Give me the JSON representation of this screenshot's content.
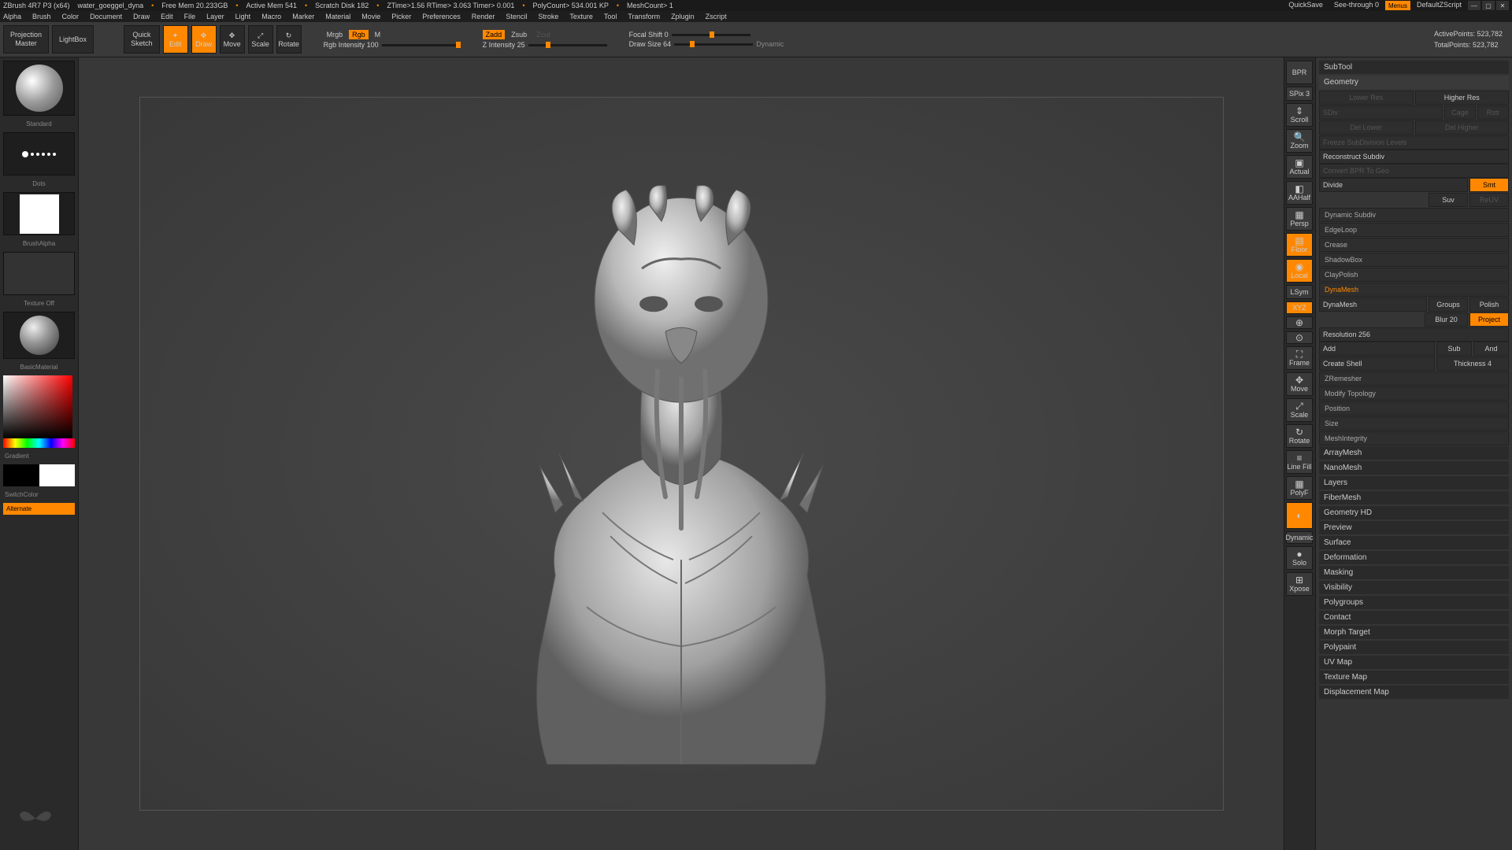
{
  "title_bar": {
    "app": "ZBrush 4R7 P3 (x64)",
    "file": "water_goeggel_dyna",
    "free_mem": "Free Mem 20.233GB",
    "active_mem": "Active Mem 541",
    "scratch": "Scratch Disk 182",
    "ztime": "ZTime>1.56 RTime> 3.063 Timer> 0.001",
    "polycount": "PolyCount> 534.001 KP",
    "meshcount": "MeshCount> 1",
    "quicksave": "QuickSave",
    "seethrough": "See-through   0",
    "menus": "Menus",
    "script": "DefaultZScript"
  },
  "menu": [
    "Alpha",
    "Brush",
    "Color",
    "Document",
    "Draw",
    "Edit",
    "File",
    "Layer",
    "Light",
    "Macro",
    "Marker",
    "Material",
    "Movie",
    "Picker",
    "Preferences",
    "Render",
    "Stencil",
    "Stroke",
    "Texture",
    "Tool",
    "Transform",
    "Zplugin",
    "Zscript"
  ],
  "shelf": {
    "projection": "Projection\nMaster",
    "lightbox": "LightBox",
    "quicksketch": "Quick\nSketch",
    "edit": "Edit",
    "draw": "Draw",
    "move": "Move",
    "scale": "Scale",
    "rotate": "Rotate",
    "mrgb": "Mrgb",
    "rgb": "Rgb",
    "m": "M",
    "rgb_intensity": "Rgb Intensity 100",
    "zadd": "Zadd",
    "zsub": "Zsub",
    "zcut": "Zcut",
    "z_intensity": "Z Intensity 25",
    "focal": "Focal Shift 0",
    "drawsize": "Draw Size 64",
    "dynamic": "Dynamic",
    "active_pts": "ActivePoints: 523,782",
    "total_pts": "TotalPoints: 523,782"
  },
  "left": {
    "brush": "Standard",
    "stroke": "Dots",
    "alpha": "BrushAlpha",
    "texture": "Texture Off",
    "material": "BasicMaterial",
    "gradient": "Gradient",
    "switch": "SwitchColor",
    "alternate": "Alternate"
  },
  "right_nav": [
    "BPR",
    "SPix 3",
    "Scroll",
    "Zoom",
    "Actual",
    "AAHalf",
    "Persp",
    "Floor",
    "Local",
    "LSym",
    "XYZ",
    "",
    "",
    "Frame",
    "Move",
    "Scale",
    "Rotate",
    "Line Fill",
    "PolyF",
    "",
    "Dynamic",
    "Solo",
    "Xpose"
  ],
  "panel": {
    "subtool": "SubTool",
    "geometry": "Geometry",
    "lower_res": "Lower Res",
    "higher_res": "Higher Res",
    "sdiv": "SDiv",
    "del_lower": "Del Lower",
    "del_higher": "Del Higher",
    "freeze": "Freeze SubDivision Levels",
    "reconstruct": "Reconstruct Subdiv",
    "convert": "Convert BPR To Geo",
    "divide": "Divide",
    "smt": "Smt",
    "suv": "Suv",
    "rstr": "ReUV",
    "dynamic_subdiv": "Dynamic Subdiv",
    "edgeloop": "EdgeLoop",
    "crease": "Crease",
    "shadowbox": "ShadowBox",
    "claypolish": "ClayPolish",
    "dynamesh_hdr": "DynaMesh",
    "dynamesh": "DynaMesh",
    "groups": "Groups",
    "polish": "Polish",
    "blur": "Blur 20",
    "project": "Project",
    "resolution": "Resolution 256",
    "add": "Add",
    "sub": "Sub",
    "and": "And",
    "create_shell": "Create Shell",
    "thickness": "Thickness 4",
    "zremesher": "ZRemesher",
    "modify": "Modify Topology",
    "position": "Position",
    "size": "Size",
    "meshintegrity": "MeshIntegrity",
    "arraymesh": "ArrayMesh",
    "nanomesh": "NanoMesh",
    "layers": "Layers",
    "fibermesh": "FiberMesh",
    "geo_hd": "Geometry HD",
    "preview": "Preview",
    "surface": "Surface",
    "deformation": "Deformation",
    "masking": "Masking",
    "visibility": "Visibility",
    "polygroups": "Polygroups",
    "contact": "Contact",
    "morph": "Morph Target",
    "polypaint": "Polypaint",
    "uvmap": "UV Map",
    "texmap": "Texture Map",
    "dispmap": "Displacement Map"
  }
}
